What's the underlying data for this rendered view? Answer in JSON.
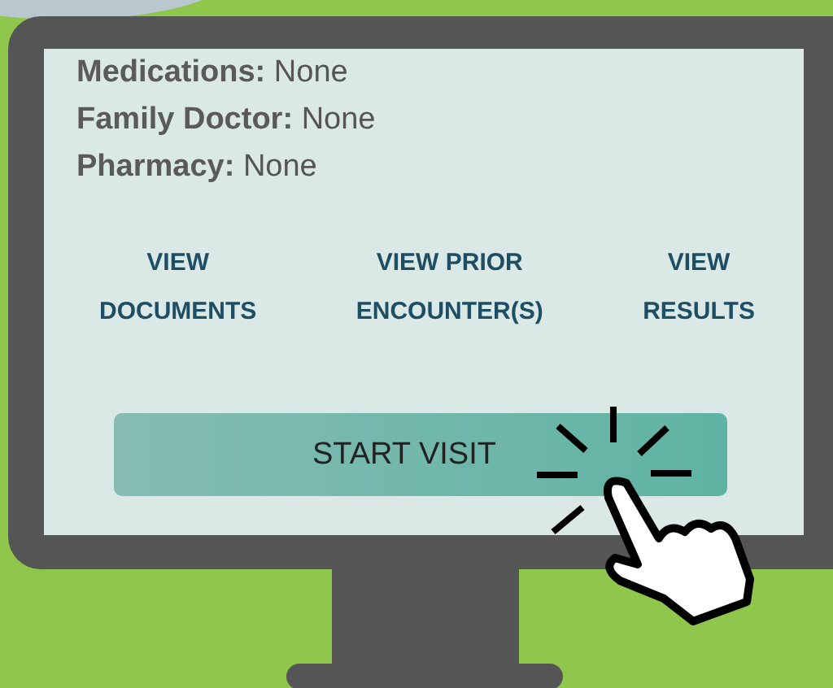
{
  "fields": [
    {
      "label": "Medications:",
      "value": "None"
    },
    {
      "label": "Family Doctor:",
      "value": "None"
    },
    {
      "label": "Pharmacy:",
      "value": "None"
    }
  ],
  "links": [
    {
      "lines": [
        "VIEW",
        "DOCUMENTS"
      ]
    },
    {
      "lines": [
        "VIEW PRIOR",
        "ENCOUNTER(S)"
      ]
    },
    {
      "lines": [
        "VIEW",
        "RESULTS"
      ]
    }
  ],
  "start_button": {
    "label": "START VISIT"
  }
}
